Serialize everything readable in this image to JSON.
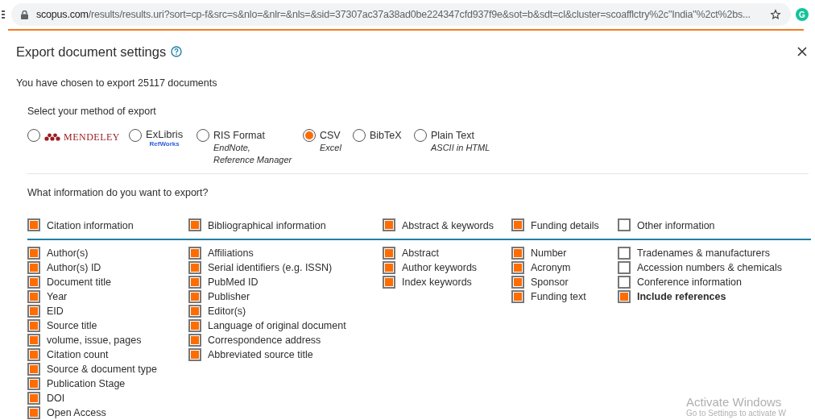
{
  "address_bar": {
    "domain": "scopus.com",
    "path": "/results/results.uri?sort=cp-f&src=s&nlo=&nlr=&nls=&sid=37307ac37a38ad0be224347cfd937f9e&sot=b&sdt=cl&cluster=scoafflctry%2c\"India\"%2ct%2bs...",
    "extension_label": "G"
  },
  "dialog": {
    "title": "Export document settings",
    "summary": "You have chosen to export 25117 documents",
    "method_heading": "Select your method of export",
    "methods": [
      {
        "kind": "mendeley",
        "label": "MENDELEY",
        "selected": false
      },
      {
        "kind": "exlibris",
        "label": "ExLibris",
        "sublabel": "RefWorks",
        "selected": false
      },
      {
        "kind": "text",
        "label": "RIS Format",
        "notes": [
          "EndNote,",
          "Reference Manager"
        ],
        "selected": false
      },
      {
        "kind": "text",
        "label": "CSV",
        "notes": [
          "Excel"
        ],
        "selected": true
      },
      {
        "kind": "text",
        "label": "BibTeX",
        "selected": false
      },
      {
        "kind": "text",
        "label": "Plain Text",
        "notes": [
          "ASCII in HTML"
        ],
        "selected": false
      }
    ],
    "info_heading": "What information do you want to export?",
    "groups": [
      {
        "label": "Citation information",
        "checked": true,
        "items": [
          {
            "label": "Author(s)",
            "checked": true
          },
          {
            "label": "Author(s) ID",
            "checked": true
          },
          {
            "label": "Document title",
            "checked": true
          },
          {
            "label": "Year",
            "checked": true
          },
          {
            "label": "EID",
            "checked": true
          },
          {
            "label": "Source title",
            "checked": true
          },
          {
            "label": "volume, issue, pages",
            "checked": true
          },
          {
            "label": "Citation count",
            "checked": true
          },
          {
            "label": "Source & document type",
            "checked": true
          },
          {
            "label": "Publication Stage",
            "checked": true
          },
          {
            "label": "DOI",
            "checked": true
          },
          {
            "label": "Open Access",
            "checked": true
          }
        ]
      },
      {
        "label": "Bibliographical information",
        "checked": true,
        "items": [
          {
            "label": "Affiliations",
            "checked": true
          },
          {
            "label": "Serial identifiers (e.g. ISSN)",
            "checked": true
          },
          {
            "label": "PubMed ID",
            "checked": true
          },
          {
            "label": "Publisher",
            "checked": true
          },
          {
            "label": "Editor(s)",
            "checked": true
          },
          {
            "label": "Language of original document",
            "checked": true
          },
          {
            "label": "Correspondence address",
            "checked": true
          },
          {
            "label": "Abbreviated source title",
            "checked": true
          }
        ]
      },
      {
        "label": "Abstract & keywords",
        "checked": true,
        "items": [
          {
            "label": "Abstract",
            "checked": true
          },
          {
            "label": "Author keywords",
            "checked": true
          },
          {
            "label": "Index keywords",
            "checked": true
          }
        ]
      },
      {
        "label": "Funding details",
        "checked": true,
        "items": [
          {
            "label": "Number",
            "checked": true
          },
          {
            "label": "Acronym",
            "checked": true
          },
          {
            "label": "Sponsor",
            "checked": true
          },
          {
            "label": "Funding text",
            "checked": true
          }
        ]
      },
      {
        "label": "Other information",
        "checked": false,
        "items": [
          {
            "label": "Tradenames & manufacturers",
            "checked": false
          },
          {
            "label": "Accession numbers & chemicals",
            "checked": false
          },
          {
            "label": "Conference information",
            "checked": false
          },
          {
            "label": "Include references",
            "checked": true,
            "bold": true
          }
        ]
      }
    ]
  },
  "os_notice": {
    "title": "Activate Windows",
    "text": "Go to Settings to activate W"
  }
}
